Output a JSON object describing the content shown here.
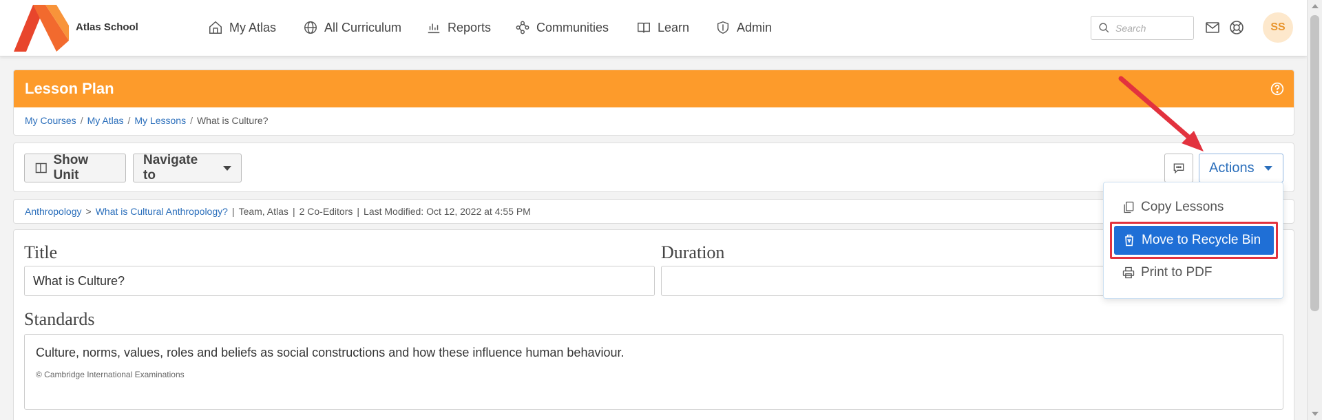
{
  "app": {
    "school_name": "Atlas School",
    "brand_color": "#e8452c"
  },
  "nav": {
    "items": [
      {
        "label": "My Atlas",
        "icon": "home-icon"
      },
      {
        "label": "All Curriculum",
        "icon": "globe-icon"
      },
      {
        "label": "Reports",
        "icon": "bar-chart-icon"
      },
      {
        "label": "Communities",
        "icon": "network-icon"
      },
      {
        "label": "Learn",
        "icon": "book-icon"
      },
      {
        "label": "Admin",
        "icon": "shield-icon"
      }
    ],
    "search_placeholder": "Search",
    "avatar_initials": "SS"
  },
  "lesson_plan": {
    "title": "Lesson Plan",
    "header_color": "#fd9b2b",
    "breadcrumb": [
      "My Courses",
      "My Atlas",
      "My Lessons",
      "What is Culture?"
    ]
  },
  "toolbar": {
    "show_unit": "Show Unit",
    "navigate_to": "Navigate to",
    "actions": "Actions"
  },
  "actions_menu": {
    "items": [
      "Copy Lessons",
      "Move to Recycle Bin",
      "Print to PDF"
    ],
    "highlighted": "Move to Recycle Bin",
    "highlight_color": "#1f6fd6"
  },
  "meta": {
    "subject": "Anthropology",
    "unit": "What is Cultural Anthropology?",
    "team": "Team, Atlas",
    "co_editors": "2 Co-Editors",
    "last_modified": "Last Modified: Oct 12, 2022 at 4:55 PM"
  },
  "form": {
    "title_label": "Title",
    "title_value": "What is Culture?",
    "duration_label": "Duration",
    "duration_value": "",
    "standards_label": "Standards",
    "standard_text": "Culture, norms, values, roles and beliefs as social constructions and how these influence human behaviour.",
    "standard_source": "© Cambridge International Examinations"
  }
}
